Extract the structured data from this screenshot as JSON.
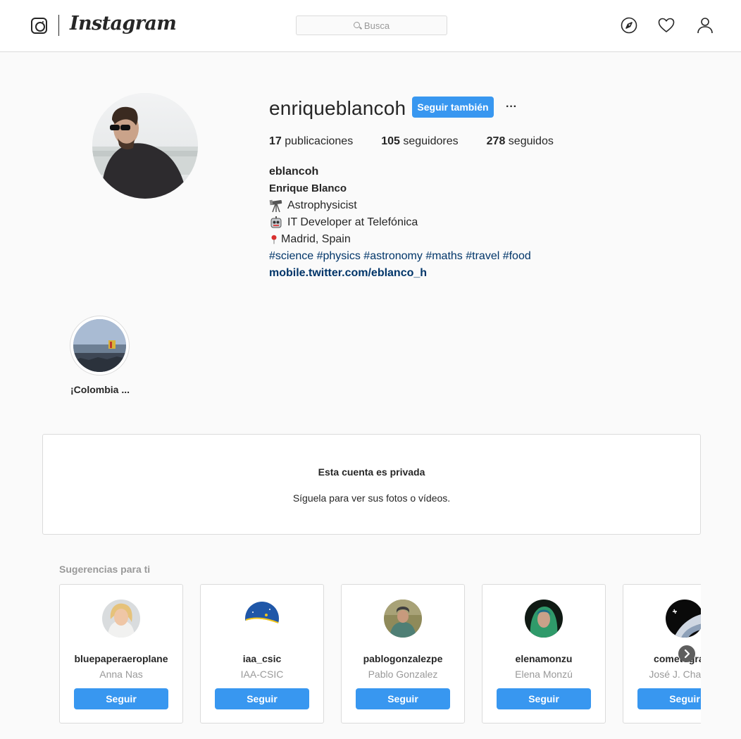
{
  "nav": {
    "wordmark": "Instagram",
    "search_placeholder": "Busca",
    "icons": [
      "compass-icon",
      "heart-icon",
      "person-icon"
    ]
  },
  "profile": {
    "username": "enriqueblancoh",
    "follow_label": "Seguir también",
    "more_label": "···",
    "stats": {
      "posts_count": "17",
      "posts_label": "publicaciones",
      "followers_count": "105",
      "followers_label": "seguidores",
      "following_count": "278",
      "following_label": "seguidos"
    },
    "bio": {
      "handle": "eblancoh",
      "full_name": "Enrique Blanco",
      "lines": [
        "Astrophysicist",
        "IT Developer at Telefónica",
        "Madrid, Spain"
      ],
      "hashtags": "#science #physics #astronomy #maths #travel #food",
      "link": "mobile.twitter.com/eblanco_h"
    }
  },
  "highlight": {
    "label": "¡Colombia ..."
  },
  "private_notice": {
    "title": "Esta cuenta es privada",
    "subtitle": "Síguela para ver sus fotos o vídeos."
  },
  "suggestions": {
    "title": "Sugerencias para ti",
    "button_label": "Seguir",
    "cards": [
      {
        "username": "bluepaperaeroplane",
        "name": "Anna Nas"
      },
      {
        "username": "iaa_csic",
        "name": "IAA-CSIC"
      },
      {
        "username": "pablogonzalezpe",
        "name": "Pablo Gonzalez"
      },
      {
        "username": "elenamonzu",
        "name": "Elena Monzú"
      },
      {
        "username": "cometografía",
        "name": "José J. Chambó"
      }
    ]
  },
  "colors": {
    "accent": "#3897f0",
    "link": "#003569",
    "border": "#dbdbdb",
    "muted": "#999999",
    "background": "#fafafa"
  }
}
